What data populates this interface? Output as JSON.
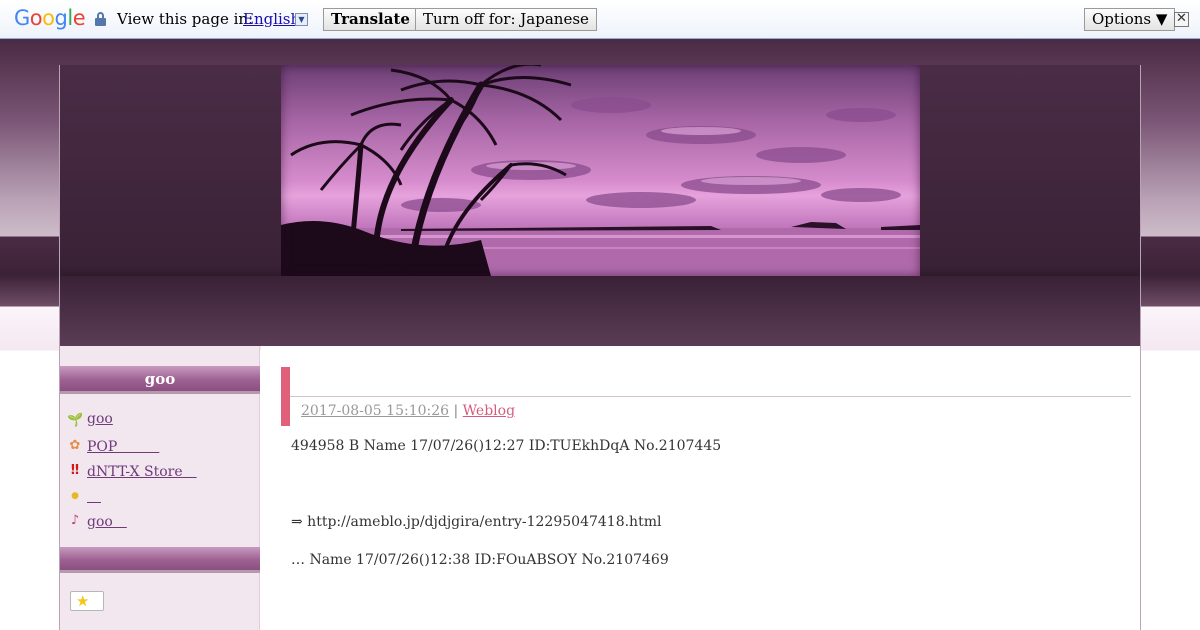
{
  "translate_bar": {
    "logo": "Google",
    "view_text": "View this page in:",
    "language": "English",
    "dropdown_glyph": "▼",
    "translate_button": "Translate",
    "turn_off_button": "Turn off for: Japanese",
    "options_button": "Options ▼",
    "close_glyph": "✕"
  },
  "sidebar": {
    "heading": "goo",
    "items": [
      {
        "icon": "sprout-icon",
        "glyph": "🌱",
        "label": "goo"
      },
      {
        "icon": "flower-icon",
        "glyph": "✿",
        "label": "POP　　　"
      },
      {
        "icon": "double-exclamation-icon",
        "glyph": "‼",
        "label": "dNTT-X Store　"
      },
      {
        "icon": "bulb-icon",
        "glyph": "●",
        "label": "　"
      },
      {
        "icon": "music-note-icon",
        "glyph": "♪",
        "label": "goo　"
      }
    ],
    "star_glyph": "★"
  },
  "post": {
    "date": "2017-08-05 15:10:26",
    "separator": "|",
    "category": "Weblog",
    "lines": [
      "494958 B Name  17/07/26()12:27 ID:TUEkhDqA No.2107445",
      "⇒ http://ameblo.jp/djdjgira/entry-12295047418.html",
      "…  Name  17/07/26()12:38 ID:FOuABSOY No.2107469"
    ]
  },
  "colors": {
    "accent_pink": "#e0607a",
    "sidebar_header": "#9e6292",
    "link": "#6e3a7a"
  }
}
